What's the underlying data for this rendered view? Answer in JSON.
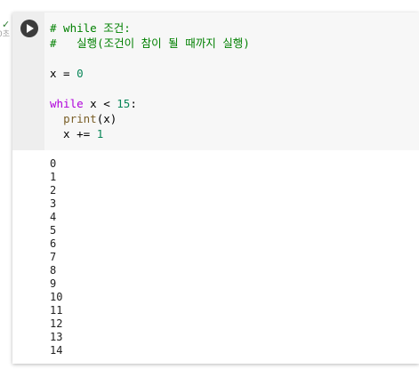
{
  "status": {
    "check_icon": "check-icon",
    "check_color": "#2e7d32",
    "time_label": "0초"
  },
  "cell": {
    "run_icon": "play-icon",
    "code": {
      "line1": "# while 조건:",
      "line2": "#   실행(조건이 참이 될 때까지 실행)",
      "line4_var": "x",
      "line4_op": " = ",
      "line4_num": "0",
      "line6_kw": "while",
      "line6_rest": " x < ",
      "line6_num": "15",
      "line6_colon": ":",
      "line7_indent": "  ",
      "line7_fn": "print",
      "line7_rest": "(x)",
      "line8_rest": "  x += ",
      "line8_num": "1"
    },
    "output_lines": [
      "0",
      "1",
      "2",
      "3",
      "4",
      "5",
      "6",
      "7",
      "8",
      "9",
      "10",
      "11",
      "12",
      "13",
      "14"
    ]
  }
}
